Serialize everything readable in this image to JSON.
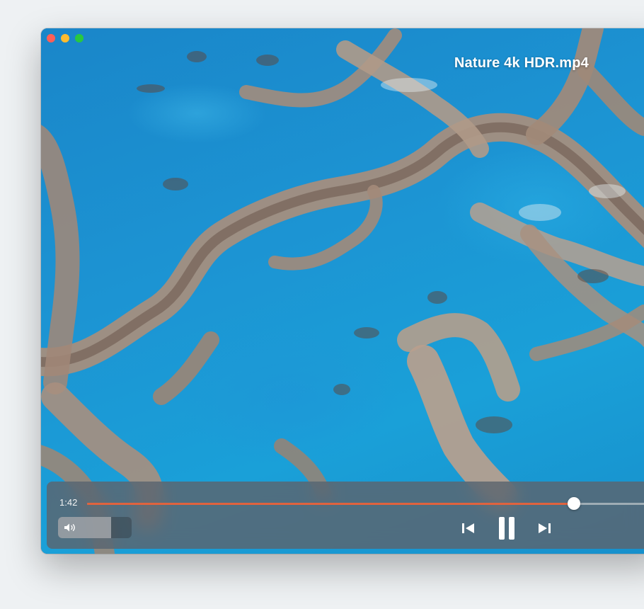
{
  "window": {
    "traffic_lights": {
      "close_color": "#fe5f57",
      "minimize_color": "#febc2e",
      "zoom_color": "#28c840"
    }
  },
  "video": {
    "title": "Nature 4k HDR.mp4"
  },
  "controls": {
    "current_time": "1:42",
    "progress_percent": 86,
    "volume_percent": 72,
    "accent_color": "#e0633e",
    "icons": {
      "volume": "speaker-icon",
      "previous": "skip-previous-icon",
      "play_pause": "pause-icon",
      "next": "skip-next-icon"
    }
  }
}
